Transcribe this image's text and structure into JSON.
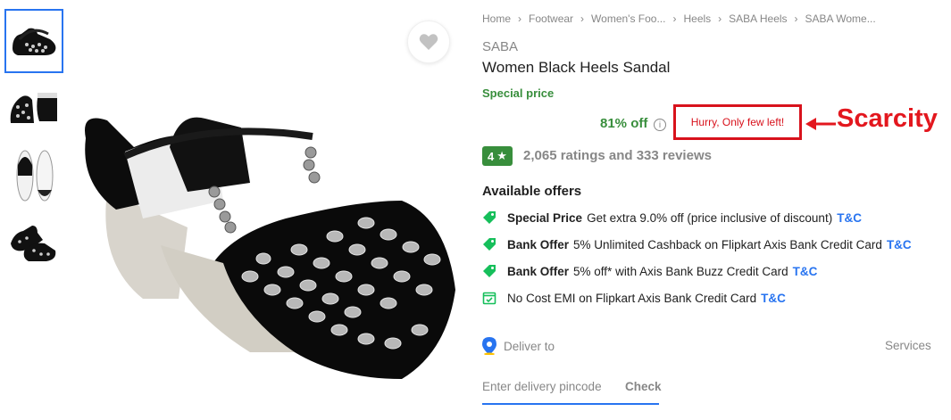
{
  "breadcrumb": [
    "Home",
    "Footwear",
    "Women's Foo...",
    "Heels",
    "SABA Heels",
    "SABA Wome..."
  ],
  "product": {
    "brand": "SABA",
    "title": "Women Black Heels Sandal",
    "special_price": "Special price",
    "discount": "81% off",
    "info_glyph": "i",
    "stock_alert": "Hurry, Only few left!",
    "rating": "4",
    "rating_star": "★",
    "rating_summary": "2,065 ratings and 333 reviews"
  },
  "annotation": {
    "label": "Scarcity",
    "color": "#e3171e"
  },
  "offers": {
    "heading": "Available offers",
    "items": [
      {
        "title": "Special Price",
        "text": "Get extra 9.0% off (price inclusive of discount)",
        "link": "T&C",
        "icon": "tag-icon"
      },
      {
        "title": "Bank Offer",
        "text": "5% Unlimited Cashback on Flipkart Axis Bank Credit Card",
        "link": "T&C",
        "icon": "tag-icon"
      },
      {
        "title": "Bank Offer",
        "text": "5% off* with Axis Bank Buzz Credit Card",
        "link": "T&C",
        "icon": "tag-icon"
      },
      {
        "title": "",
        "text": "No Cost EMI on Flipkart Axis Bank Credit Card",
        "link": "T&C",
        "icon": "calendar-icon"
      }
    ]
  },
  "delivery": {
    "label": "Deliver to",
    "services_label": "Services",
    "pincode_placeholder": "Enter delivery pincode",
    "check_label": "Check"
  },
  "colors": {
    "accent": "#2874f0",
    "green": "#388e3c",
    "alert": "#d8121c"
  }
}
